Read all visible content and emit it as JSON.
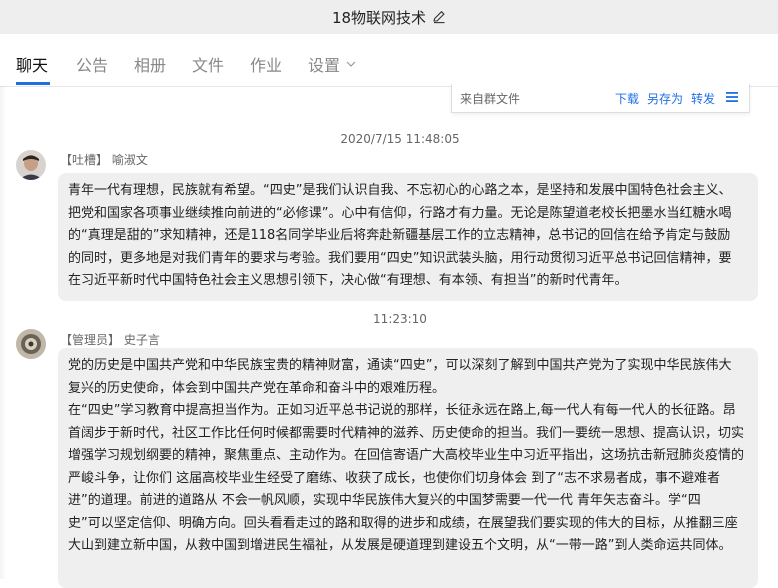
{
  "window": {
    "title": "18物联网技术"
  },
  "tabs": [
    {
      "label": "聊天"
    },
    {
      "label": "公告"
    },
    {
      "label": "相册"
    },
    {
      "label": "文件"
    },
    {
      "label": "作业"
    },
    {
      "label": "设置"
    }
  ],
  "file_bar": {
    "name": "来自群文件",
    "download": "下载",
    "save_as": "另存为",
    "forward": "转发"
  },
  "messages": [
    {
      "timestamp": "2020/7/15 11:48:05",
      "role": "【吐槽】",
      "sender": "喻淑文",
      "text": "青年一代有理想，民族就有希望。“四史”是我们认识自我、不忘初心的心路之本，是坚持和发展中国特色社会主义、\n把党和国家各项事业继续推向前进的“必修课”。心中有信仰，行路才有力量。无论是陈望道老校长把墨水当红糖水喝\n的“真理是甜的”求知精神，还是118名同学毕业后将奔赴新疆基层工作的立志精神，总书记的回信在给予肯定与鼓励\n的同时，更多地是对我们青年的要求与考验。我们要用“四史”知识武装头脑，用行动贯彻习近平总书记回信精神，要\n在习近平新时代中国特色社会主义思想引领下，决心做“有理想、有本领、有担当”的新时代青年。"
    },
    {
      "timestamp": "11:23:10",
      "role": "【管理员】",
      "sender": "史子言",
      "text": "党的历史是中国共产党和中华民族宝贵的精神财富，通读“四史”，可以深刻了解到中国共产党为了实现中华民族伟大\n复兴的历史使命，体会到中国共产党在革命和奋斗中的艰难历程。\n在“四史”学习教育中提高担当作为。正如习近平总书记说的那样，长征永远在路上,每一代人有每一代人的长征路。昂\n首阔步于新时代，社区工作比任何时候都需要时代精神的滋养、历史使命的担当。我们一要统一思想、提高认识，切实\n增强学习规划纲要的精神，聚焦重点、主动作为。在回信寄语广大高校毕业生中习近平指出，这场抗击新冠肺炎疫情的\n严峻斗争，让你们 这届高校毕业生经受了磨练、收获了成长，也使你们切身体会 到了“志不求易者成，事不避难者\n进”的道理。前进的道路从 不会一帆风顺，实现中华民族伟大复兴的中国梦需要一代一代 青年矢志奋斗。学“四\n史”可以坚定信仰、明确方向。回头看看走过的路和取得的进步和成绩，在展望我们要实现的伟大的目标，从推翻三座\n大山到建立新中国，从救中国到增进民生福祉，从发展是硬道理到建设五个文明，从“一带一路”到人类命运共同体。"
    }
  ]
}
